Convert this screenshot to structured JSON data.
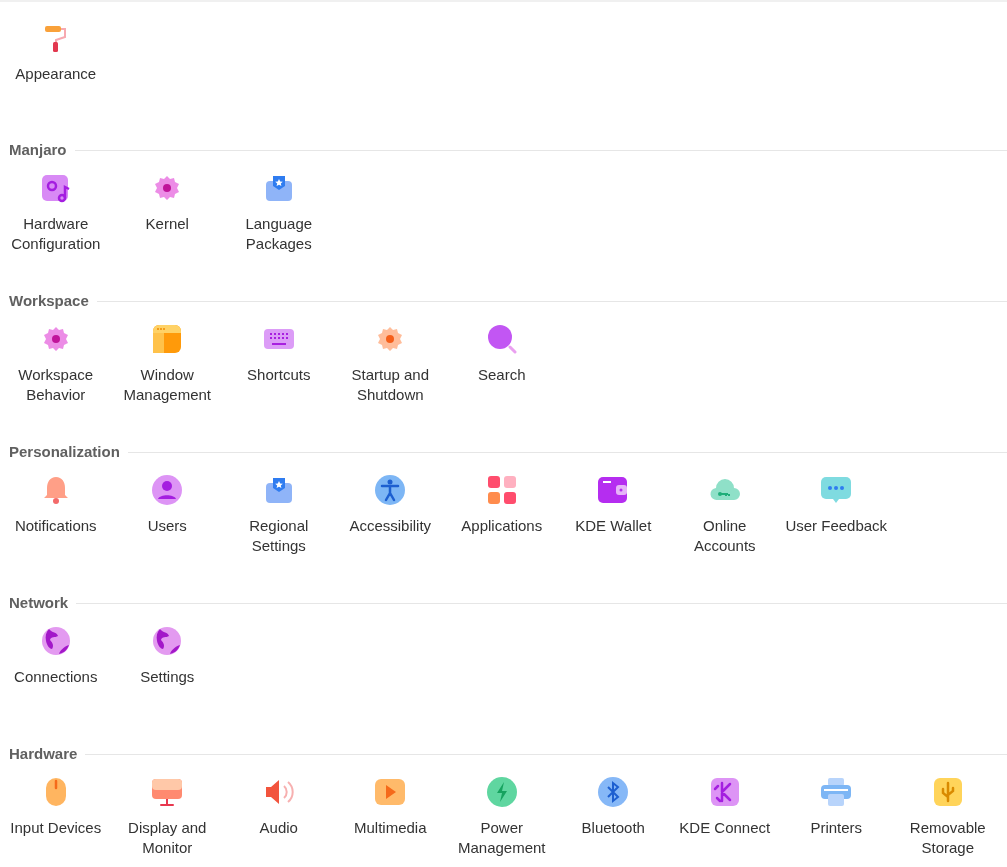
{
  "sections": [
    {
      "items": [
        {
          "label": "Appearance"
        }
      ]
    },
    {
      "title": "Manjaro",
      "items": [
        {
          "label": "Hardware Configuration"
        },
        {
          "label": "Kernel"
        },
        {
          "label": "Language Packages"
        }
      ]
    },
    {
      "title": "Workspace",
      "items": [
        {
          "label": "Workspace Behavior"
        },
        {
          "label": "Window Management"
        },
        {
          "label": "Shortcuts"
        },
        {
          "label": "Startup and Shutdown"
        },
        {
          "label": "Search"
        }
      ]
    },
    {
      "title": "Personalization",
      "items": [
        {
          "label": "Notifications"
        },
        {
          "label": "Users"
        },
        {
          "label": "Regional Settings"
        },
        {
          "label": "Accessibility"
        },
        {
          "label": "Applications"
        },
        {
          "label": "KDE Wallet"
        },
        {
          "label": "Online Accounts"
        },
        {
          "label": "User Feedback"
        }
      ]
    },
    {
      "title": "Network",
      "items": [
        {
          "label": "Connections"
        },
        {
          "label": "Settings"
        }
      ]
    },
    {
      "title": "Hardware",
      "items": [
        {
          "label": "Input Devices"
        },
        {
          "label": "Display and Monitor"
        },
        {
          "label": "Audio"
        },
        {
          "label": "Multimedia"
        },
        {
          "label": "Power Management"
        },
        {
          "label": "Bluetooth"
        },
        {
          "label": "KDE Connect"
        },
        {
          "label": "Printers"
        },
        {
          "label": "Removable Storage"
        }
      ]
    }
  ]
}
